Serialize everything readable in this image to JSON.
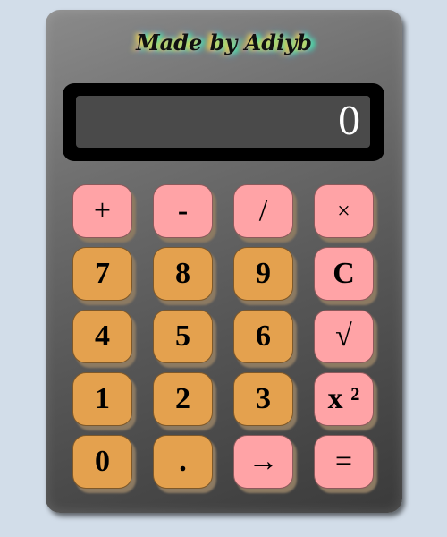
{
  "title": "Made by Adiyb",
  "display": {
    "value": "0"
  },
  "keys": [
    {
      "label": "+",
      "kind": "op"
    },
    {
      "label": "-",
      "kind": "op"
    },
    {
      "label": "/",
      "kind": "op"
    },
    {
      "label": "×",
      "kind": "op"
    },
    {
      "label": "7",
      "kind": "num"
    },
    {
      "label": "8",
      "kind": "num"
    },
    {
      "label": "9",
      "kind": "num"
    },
    {
      "label": "C",
      "kind": "op"
    },
    {
      "label": "4",
      "kind": "num"
    },
    {
      "label": "5",
      "kind": "num"
    },
    {
      "label": "6",
      "kind": "num"
    },
    {
      "label": "√",
      "kind": "op"
    },
    {
      "label": "1",
      "kind": "num"
    },
    {
      "label": "2",
      "kind": "num"
    },
    {
      "label": "3",
      "kind": "num"
    },
    {
      "label": "x ²",
      "kind": "op"
    },
    {
      "label": "0",
      "kind": "num"
    },
    {
      "label": ".",
      "kind": "num"
    },
    {
      "label": "→",
      "kind": "op"
    },
    {
      "label": "=",
      "kind": "op"
    }
  ],
  "colors": {
    "operator_key": "#ffa3a6",
    "number_key": "#e4a14e",
    "display_bg": "#4a4a4a",
    "page_bg": "#d2dde9"
  }
}
